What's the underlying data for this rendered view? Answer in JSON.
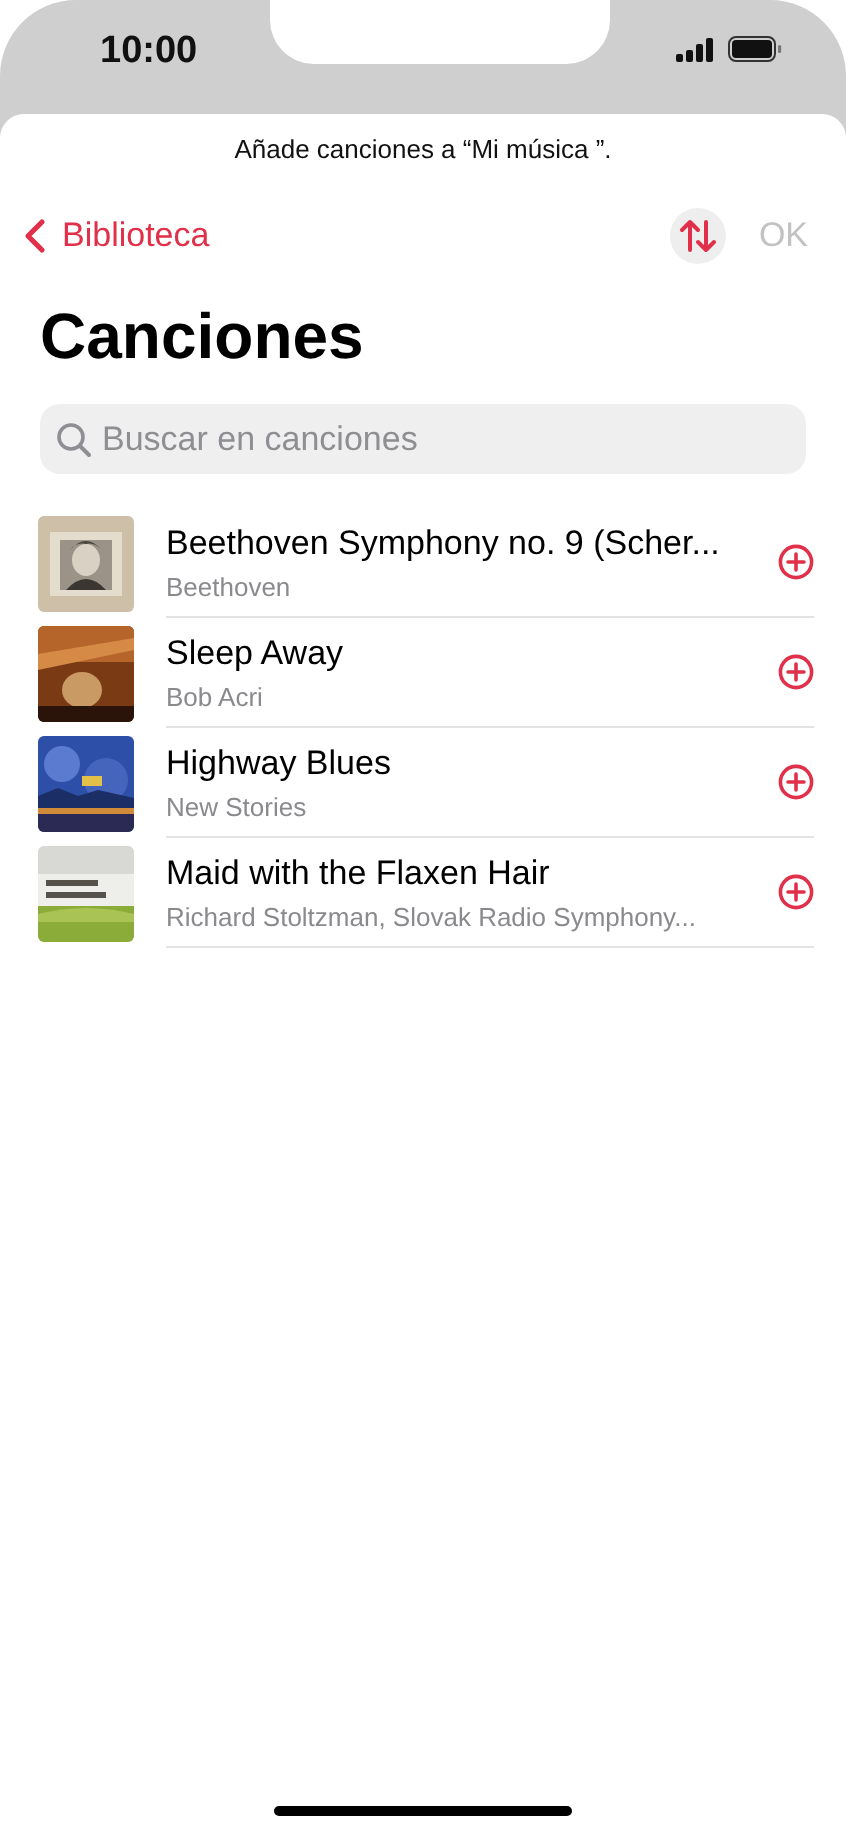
{
  "status_bar": {
    "time": "10:00"
  },
  "prompt": "Añade canciones a “Mi música ”.",
  "nav": {
    "back": "Biblioteca",
    "done": "OK",
    "done_disabled": true
  },
  "title": "Canciones",
  "search": {
    "placeholder": "Buscar en canciones"
  },
  "songs": [
    {
      "title": "Beethoven Symphony no. 9 (Scher...",
      "artist": "Beethoven"
    },
    {
      "title": "Sleep Away",
      "artist": "Bob Acri"
    },
    {
      "title": "Highway Blues",
      "artist": "New Stories"
    },
    {
      "title": "Maid with the Flaxen Hair",
      "artist": "Richard Stoltzman, Slovak Radio Symphony..."
    }
  ]
}
